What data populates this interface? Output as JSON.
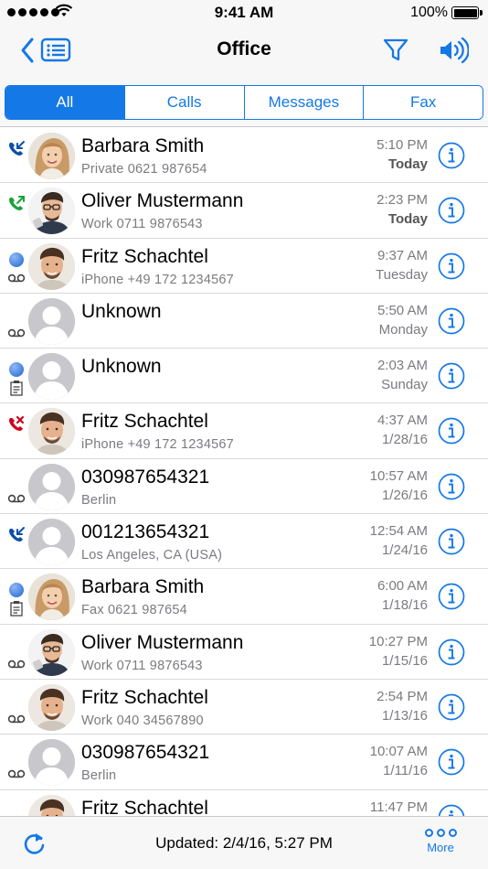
{
  "status_bar": {
    "time": "9:41 AM",
    "battery": "100%"
  },
  "nav": {
    "title": "Office"
  },
  "tabs": [
    {
      "label": "All",
      "active": true
    },
    {
      "label": "Calls",
      "active": false
    },
    {
      "label": "Messages",
      "active": false
    },
    {
      "label": "Fax",
      "active": false
    }
  ],
  "colors": {
    "accent": "#1478e6",
    "incoming": "#0a4fa8",
    "outgoing": "#17a43b",
    "missed": "#d0021b",
    "unread": "#3d7bd9"
  },
  "rows": [
    {
      "name": "Barbara Smith",
      "detail": "Private 0621 987654",
      "time": "5:10 PM",
      "date": "Today",
      "date_bold": true,
      "top_icon": "incoming-call-icon",
      "bottom_icon": "",
      "avatar": "woman"
    },
    {
      "name": "Oliver Mustermann",
      "detail": "Work 0711 9876543",
      "time": "2:23 PM",
      "date": "Today",
      "date_bold": true,
      "top_icon": "outgoing-call-icon",
      "bottom_icon": "",
      "avatar": "man-glasses"
    },
    {
      "name": "Fritz Schachtel",
      "detail": "iPhone +49 172 1234567",
      "time": "9:37 AM",
      "date": "Tuesday",
      "date_bold": false,
      "top_icon": "unread-dot-icon",
      "bottom_icon": "voicemail-icon",
      "avatar": "man"
    },
    {
      "name": "Unknown",
      "detail": "",
      "time": "5:50 AM",
      "date": "Monday",
      "date_bold": false,
      "top_icon": "",
      "bottom_icon": "voicemail-icon",
      "avatar": "placeholder"
    },
    {
      "name": "Unknown",
      "detail": "",
      "time": "2:03 AM",
      "date": "Sunday",
      "date_bold": false,
      "top_icon": "unread-dot-icon",
      "bottom_icon": "fax-icon",
      "avatar": "placeholder"
    },
    {
      "name": "Fritz Schachtel",
      "detail": "iPhone +49 172 1234567",
      "time": "4:37 AM",
      "date": "1/28/16",
      "date_bold": false,
      "top_icon": "missed-call-icon",
      "bottom_icon": "",
      "avatar": "man"
    },
    {
      "name": "030987654321",
      "detail": "Berlin",
      "time": "10:57 AM",
      "date": "1/26/16",
      "date_bold": false,
      "top_icon": "",
      "bottom_icon": "voicemail-icon",
      "avatar": "placeholder"
    },
    {
      "name": "001213654321",
      "detail": "Los Angeles, CA (USA)",
      "time": "12:54 AM",
      "date": "1/24/16",
      "date_bold": false,
      "top_icon": "incoming-call-icon",
      "bottom_icon": "",
      "avatar": "placeholder"
    },
    {
      "name": "Barbara Smith",
      "detail": "Fax 0621 987654",
      "time": "6:00 AM",
      "date": "1/18/16",
      "date_bold": false,
      "top_icon": "unread-dot-icon",
      "bottom_icon": "fax-icon",
      "avatar": "woman"
    },
    {
      "name": "Oliver Mustermann",
      "detail": "Work 0711 9876543",
      "time": "10:27 PM",
      "date": "1/15/16",
      "date_bold": false,
      "top_icon": "",
      "bottom_icon": "voicemail-icon",
      "avatar": "man-glasses"
    },
    {
      "name": "Fritz Schachtel",
      "detail": "Work 040 34567890",
      "time": "2:54 PM",
      "date": "1/13/16",
      "date_bold": false,
      "top_icon": "",
      "bottom_icon": "voicemail-icon",
      "avatar": "man"
    },
    {
      "name": "030987654321",
      "detail": "Berlin",
      "time": "10:07 AM",
      "date": "1/11/16",
      "date_bold": false,
      "top_icon": "",
      "bottom_icon": "voicemail-icon",
      "avatar": "placeholder"
    },
    {
      "name": "Fritz Schachtel",
      "detail": "",
      "time": "11:47 PM",
      "date": "",
      "date_bold": false,
      "top_icon": "",
      "bottom_icon": "",
      "avatar": "man"
    }
  ],
  "toolbar": {
    "updated": "Updated: 2/4/16, 5:27 PM",
    "more_label": "More"
  }
}
